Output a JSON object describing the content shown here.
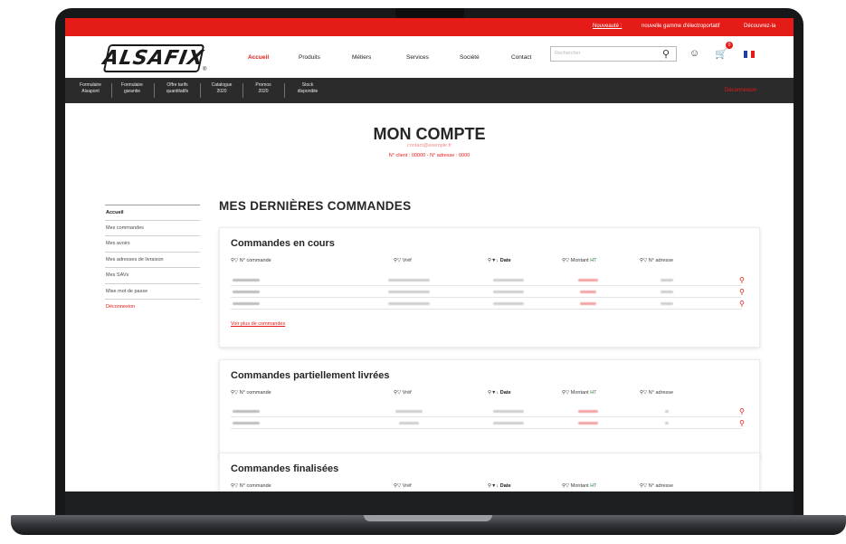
{
  "topbar": {
    "promo_link": "Nouveauté :",
    "promo_text": "nouvelle gamme d'électroportatif",
    "promo_cta": "Découvrez-la"
  },
  "header": {
    "logo_text": "ALSAFIX",
    "logo_reg": "®",
    "nav": [
      "Accueil",
      "Produits",
      "Métiers",
      "Services",
      "Société",
      "Contact"
    ],
    "active_nav": "Accueil",
    "search_placeholder": "Rechercher",
    "cart_count": "0"
  },
  "subnav": {
    "items": [
      {
        "line1": "Formulaire",
        "line2": "Alsapont"
      },
      {
        "line1": "Formulaire",
        "line2": "garantie"
      },
      {
        "line1": "Offre tarifs",
        "line2": "quantitatifs"
      },
      {
        "line1": "Catalogue",
        "line2": "2020"
      },
      {
        "line1": "Promos",
        "line2": "2020"
      },
      {
        "line1": "Stock",
        "line2": "disponible"
      }
    ],
    "right_label": "Déconnexion"
  },
  "account": {
    "title": "MON COMPTE",
    "email": "contact@exemple.fr",
    "client_line": "N° client : 00000 - N° adresse : 0000"
  },
  "sidebar": {
    "items": [
      "Accueil",
      "Mes commandes",
      "Mes avoirs",
      "Mes adresses de livraison",
      "Mes SAVs",
      "Mise mot de passe",
      "Déconnexion"
    ]
  },
  "orders": {
    "section_title": "MES DERNIÈRES COMMANDES",
    "headers": {
      "number": "N° commande",
      "ref": "Vréf",
      "date": "Date",
      "amount_prefix": "Montant ",
      "amount_ht": "HT",
      "address": "N° adresse"
    },
    "cards": [
      {
        "title": "Commandes en cours",
        "rows": 3,
        "link": "Voir plus de commandes"
      },
      {
        "title": "Commandes partiellement livrées",
        "rows": 2,
        "link": ""
      },
      {
        "title": "Commandes finalisées",
        "rows": 0,
        "link": ""
      }
    ]
  },
  "colors": {
    "brand_red": "#e41b17",
    "dark_bar": "#2b2b2b",
    "accent_green": "#2a7d3a"
  }
}
